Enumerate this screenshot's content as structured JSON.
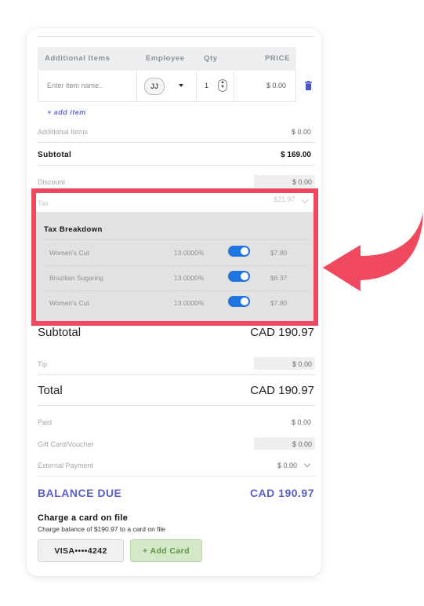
{
  "additional_items_table": {
    "headers": {
      "item": "Additional Items",
      "employee": "Employee",
      "qty": "Qty",
      "price": "PRICE"
    },
    "row": {
      "item_placeholder": "Enter item name..",
      "employee_initials": "JJ",
      "qty": "1",
      "price": "$ 0.00"
    },
    "add_item_link": "+ add item"
  },
  "summary": {
    "additional_items": {
      "label": "Additional Items",
      "value": "$ 0.00"
    },
    "subtotal": {
      "label": "Subtotal",
      "value": "$ 169.00"
    },
    "discount": {
      "label": "Discount",
      "value": "$ 0.00"
    },
    "tax": {
      "label": "Tax",
      "value": "$21.97"
    }
  },
  "tax_breakdown": {
    "title": "Tax Breakdown",
    "rows": [
      {
        "name": "Women's Cut",
        "rate": "13.0000%",
        "enabled": true,
        "amount": "$7.80"
      },
      {
        "name": "Brazilian Sugaring",
        "rate": "13.0000%",
        "enabled": true,
        "amount": "$6.37"
      },
      {
        "name": "Women's Cut",
        "rate": "13.0000%",
        "enabled": true,
        "amount": "$7.80"
      }
    ]
  },
  "totals": {
    "subtotal": {
      "label": "Subtotal",
      "value": "CAD 190.97"
    },
    "tip": {
      "label": "Tip",
      "value": "$ 0.00"
    },
    "total": {
      "label": "Total",
      "value": "CAD 190.97"
    },
    "paid": {
      "label": "Paid",
      "value": "$ 0.00"
    },
    "gift_card": {
      "label": "Gift Card/Voucher",
      "value": "$ 0.00"
    },
    "external_payment": {
      "label": "External Payment",
      "value": "$ 0.00"
    },
    "balance_due": {
      "label": "BALANCE DUE",
      "value": "CAD 190.97"
    }
  },
  "charge_card": {
    "title": "Charge a card on file",
    "subtitle": "Charge balance of $190.97 to a card on file",
    "visa_button": "VISA••••4242",
    "add_card_button": "+ Add Card"
  },
  "colors": {
    "highlight_border": "#f0485e",
    "arrow": "#f0485e",
    "toggle_on": "#1e74e0",
    "balance_due": "#5a5fc8",
    "add_card_bg": "#d2e8c7"
  }
}
